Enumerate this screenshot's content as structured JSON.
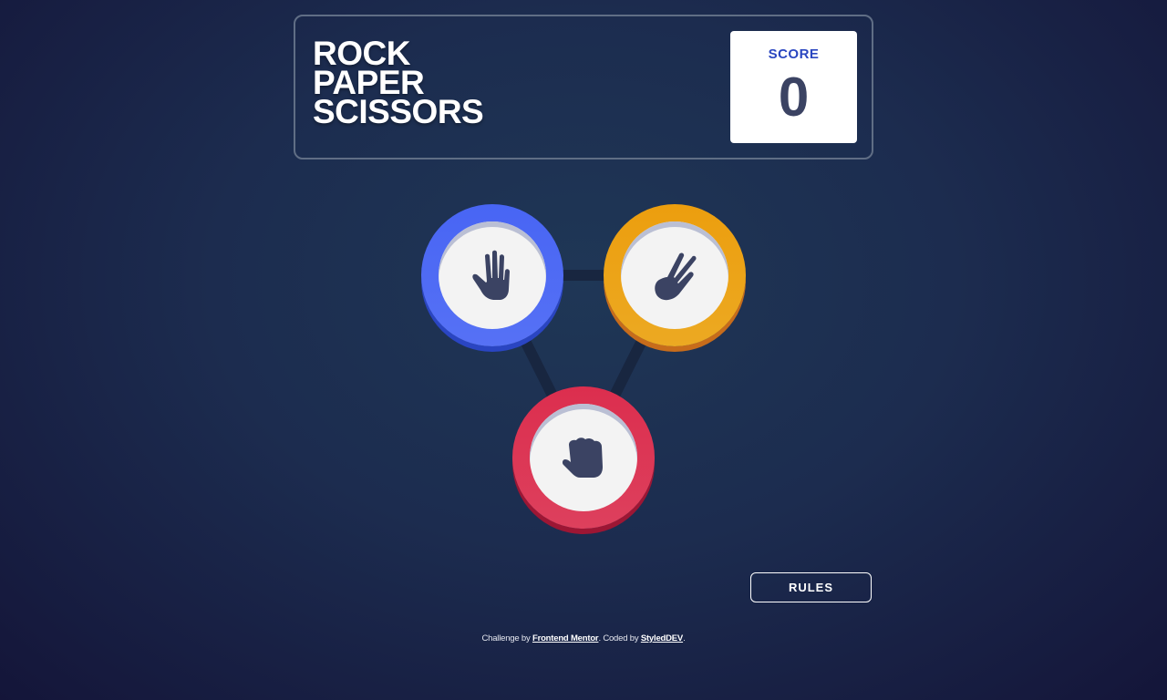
{
  "header": {
    "title_lines": [
      "ROCK",
      "PAPER",
      "SCISSORS"
    ],
    "score": {
      "label": "SCORE",
      "value": "0"
    }
  },
  "tokens": [
    {
      "choice": "paper",
      "icon": "paper-hand-icon",
      "color": "#4865f4"
    },
    {
      "choice": "scissors",
      "icon": "scissors-hand-icon",
      "color": "#ec9e0e"
    },
    {
      "choice": "rock",
      "icon": "rock-fist-icon",
      "color": "#dc2e4e"
    }
  ],
  "rules_button": {
    "label": "RULES"
  },
  "attribution": {
    "prefix": "Challenge by ",
    "challenge_link": "Frontend Mentor",
    "middle": ". Coded by ",
    "author_link": "StyledDEV",
    "suffix": "."
  },
  "colors": {
    "background_center": "#1f3756",
    "background_edge": "#141539",
    "header_outline": "#606e85",
    "score_text": "#3b4363",
    "score_label": "#2a46c0",
    "icon_fill": "#3b4363"
  }
}
